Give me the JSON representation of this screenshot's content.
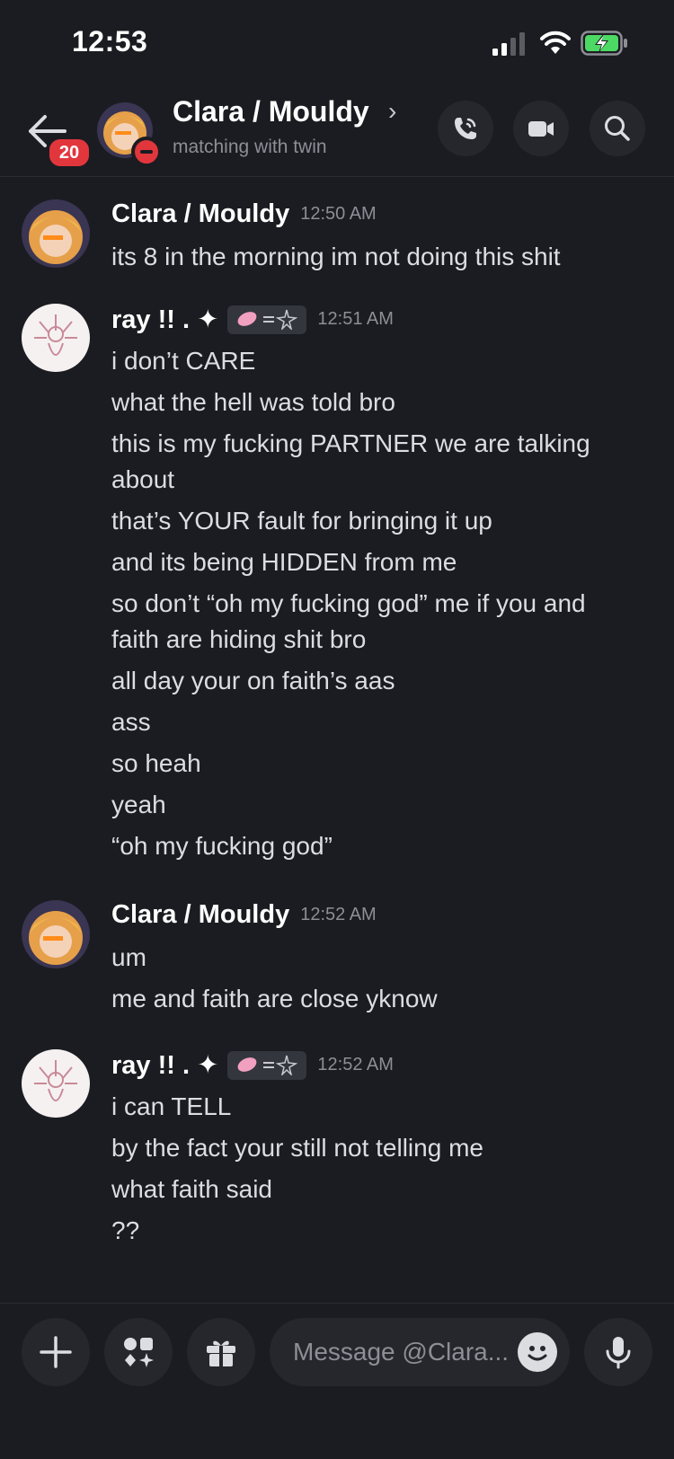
{
  "status_bar": {
    "time": "12:53"
  },
  "header": {
    "unread_count": "20",
    "title": "Clara / Mouldy",
    "subtitle": "matching with twin"
  },
  "messages": [
    {
      "author": "Clara / Mouldy",
      "time": "12:50 AM",
      "lines": [
        "its 8 in the morning im not doing this shit"
      ]
    },
    {
      "author": "ray !! . ✦",
      "time": "12:51 AM",
      "has_tag": true,
      "lines": [
        "i don’t CARE",
        "what the hell was told bro",
        "this is my fucking PARTNER we are talking about",
        "that’s YOUR fault for bringing it up",
        "and its being HIDDEN from me",
        "so don’t “oh my fucking god” me if you and faith are hiding shit bro",
        "all day your on faith’s aas",
        "ass",
        "so heah",
        "yeah",
        "“oh my fucking god”"
      ]
    },
    {
      "author": "Clara / Mouldy",
      "time": "12:52 AM",
      "lines": [
        "um",
        "me and faith are close yknow"
      ]
    },
    {
      "author": "ray !! . ✦",
      "time": "12:52 AM",
      "has_tag": true,
      "lines": [
        "i can TELL",
        "by the fact your still not telling me",
        "what faith said",
        "??"
      ]
    }
  ],
  "composer": {
    "placeholder": "Message @Clara..."
  },
  "icons": {
    "back": "back-arrow-icon",
    "call": "phone-call-icon",
    "video": "video-camera-icon",
    "search": "search-icon",
    "plus": "plus-icon",
    "apps": "apps-icon",
    "gift": "gift-icon",
    "emoji": "emoji-icon",
    "mic": "microphone-icon"
  },
  "colors": {
    "background": "#1b1c21",
    "badge": "#e2363d",
    "battery": "#4cd964"
  }
}
